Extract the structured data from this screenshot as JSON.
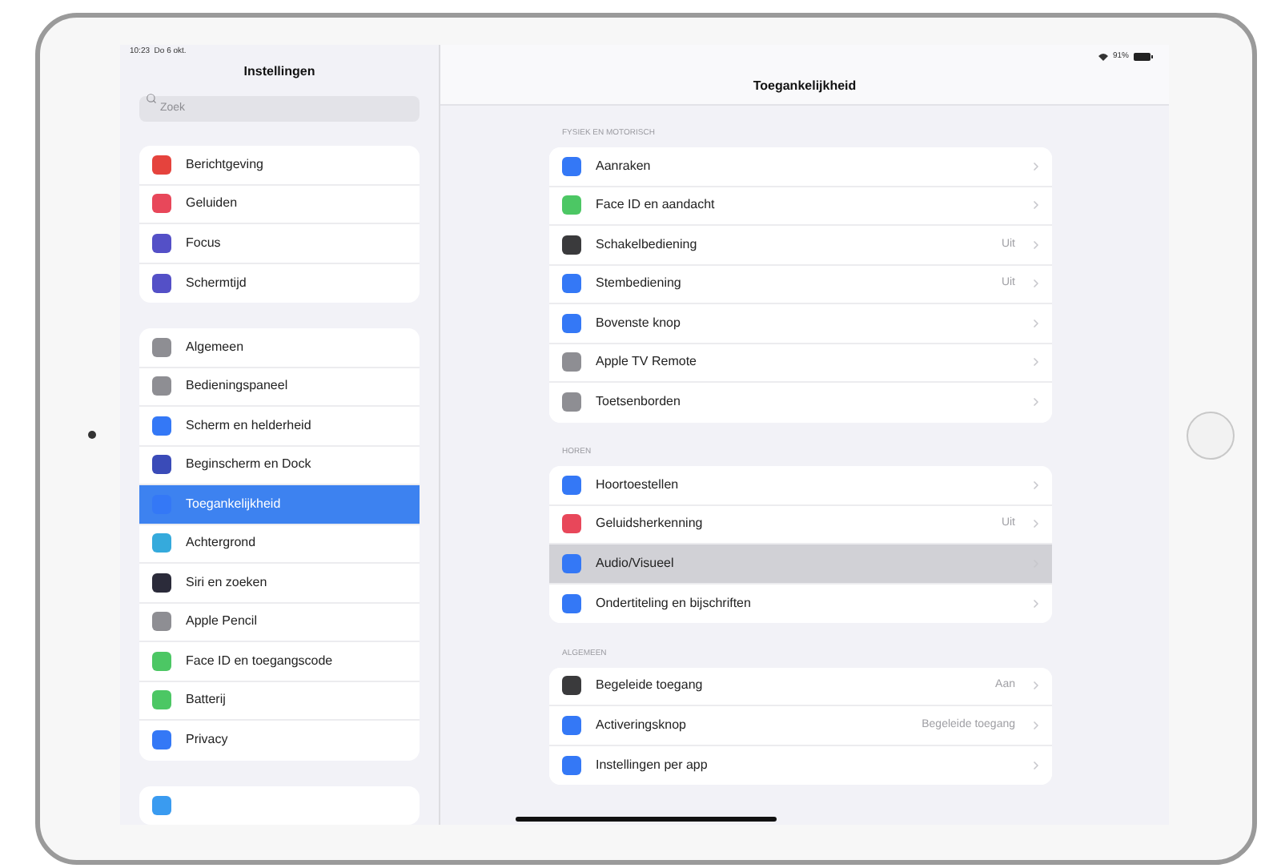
{
  "status_bar": {
    "time": "10:23  Do 6 okt.",
    "battery": "91%"
  },
  "sidebar": {
    "title": "Instellingen",
    "search": {
      "placeholder": "Zoek"
    },
    "groups": [
      {
        "items": [
          {
            "label": "Berichtgeving",
            "color": "#e5433d",
            "selected": false
          },
          {
            "label": "Geluiden",
            "color": "#e8475a",
            "selected": false
          },
          {
            "label": "Focus",
            "color": "#5450c7",
            "selected": false
          },
          {
            "label": "Schermtijd",
            "color": "#5450c7",
            "selected": false
          }
        ]
      },
      {
        "items": [
          {
            "label": "Algemeen",
            "color": "#8e8e93",
            "selected": false
          },
          {
            "label": "Bedieningspaneel",
            "color": "#8e8e93",
            "selected": false
          },
          {
            "label": "Scherm en helderheid",
            "color": "#3478f6",
            "selected": false
          },
          {
            "label": "Beginscherm en Dock",
            "color": "#3a4bb8",
            "selected": false
          },
          {
            "label": "Toegankelijkheid",
            "color": "#3478f6",
            "selected": true
          },
          {
            "label": "Achtergrond",
            "color": "#35aadc",
            "selected": false
          },
          {
            "label": "Siri en zoeken",
            "color": "#2b2b3a",
            "selected": false
          },
          {
            "label": "Apple Pencil",
            "color": "#8e8e93",
            "selected": false
          },
          {
            "label": "Face ID en toegangscode",
            "color": "#4cc764",
            "selected": false
          },
          {
            "label": "Batterij",
            "color": "#4cc764",
            "selected": false
          },
          {
            "label": "Privacy",
            "color": "#3478f6",
            "selected": false
          }
        ]
      },
      {
        "items": [
          {
            "color": "#3a9bf0",
            "selected": false
          }
        ]
      }
    ]
  },
  "detail": {
    "title": "Toegankelijkheid",
    "sections": [
      {
        "header": "FYSIEK EN MOTORISCH",
        "items": [
          {
            "label": "Aanraken",
            "color": "#3478f6",
            "selected": false
          },
          {
            "label": "Face ID en aandacht",
            "color": "#4cc764",
            "selected": false
          },
          {
            "label": "Schakelbediening",
            "color": "#3a3a3c",
            "value": "Uit",
            "selected": false
          },
          {
            "label": "Stembediening",
            "color": "#3478f6",
            "value": "Uit",
            "selected": false
          },
          {
            "label": "Bovenste knop",
            "color": "#3478f6",
            "selected": false
          },
          {
            "label": "Apple TV Remote",
            "color": "#8e8e93",
            "selected": false
          },
          {
            "label": "Toetsenborden",
            "color": "#8e8e93",
            "selected": false
          }
        ]
      },
      {
        "header": "HOREN",
        "items": [
          {
            "label": "Hoortoestellen",
            "color": "#3478f6",
            "selected": false
          },
          {
            "label": "Geluidsherkenning",
            "color": "#e8475a",
            "value": "Uit",
            "selected": false
          },
          {
            "label": "Audio/Visueel",
            "color": "#3478f6",
            "selected": true
          },
          {
            "label": "Ondertiteling en bijschriften",
            "color": "#3478f6",
            "selected": false
          }
        ]
      },
      {
        "header": "ALGEMEEN",
        "items": [
          {
            "label": "Begeleide toegang",
            "color": "#3a3a3c",
            "value": "Aan",
            "selected": false
          },
          {
            "label": "Activeringsknop",
            "color": "#3478f6",
            "value": "Begeleide toegang",
            "selected": false
          },
          {
            "label": "Instellingen per app",
            "color": "#3478f6",
            "selected": false
          }
        ]
      }
    ]
  }
}
